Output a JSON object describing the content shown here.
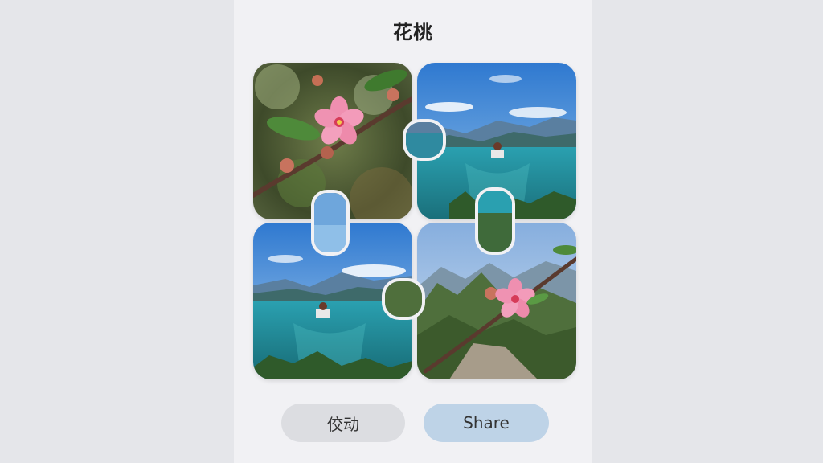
{
  "puzzle": {
    "title": "花桃"
  },
  "buttons": {
    "left_label": "佼动",
    "right_label": "Share"
  },
  "colors": {
    "sky": "#3d86d6",
    "sea": "#1f8f9a",
    "blossom": "#ef8fb0",
    "leaf": "#4e8a3a",
    "button_primary": "#bed3e7",
    "button_secondary": "#dcdde1"
  },
  "icons": [
    "peach-blossom-image",
    "lake-island-image",
    "mountain-blossom-image"
  ]
}
